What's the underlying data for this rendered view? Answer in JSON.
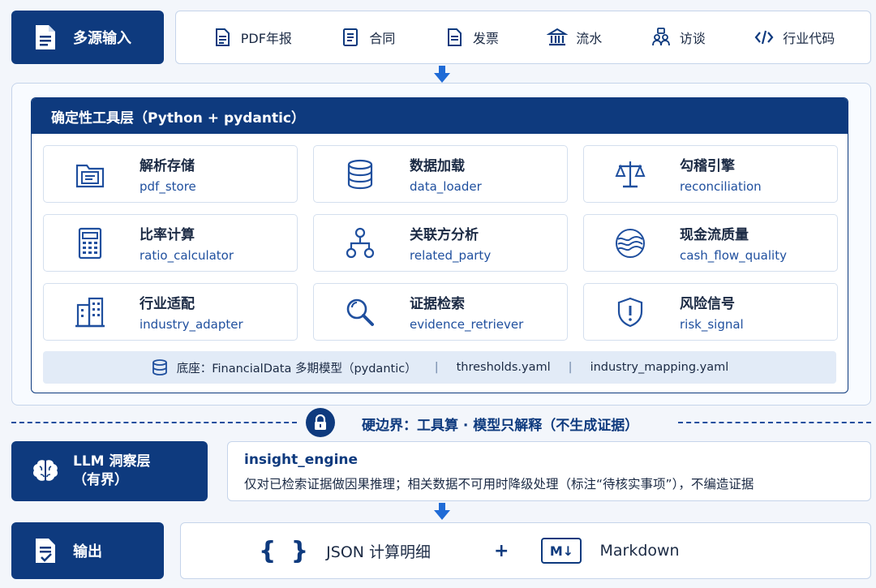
{
  "input": {
    "label": "多源输入"
  },
  "sources": [
    {
      "icon": "document-icon",
      "label": "PDF年报"
    },
    {
      "icon": "document-icon",
      "label": "合同"
    },
    {
      "icon": "receipt-icon",
      "label": "发票"
    },
    {
      "icon": "bank-icon",
      "label": "流水"
    },
    {
      "icon": "people-icon",
      "label": "访谈"
    },
    {
      "icon": "code-icon",
      "label": "行业代码"
    }
  ],
  "tools_layer": {
    "title": "确定性工具层（Python + pydantic）",
    "cards": [
      {
        "icon": "folder-icon",
        "title": "解析存储",
        "sub": "pdf_store"
      },
      {
        "icon": "database-icon",
        "title": "数据加载",
        "sub": "data_loader"
      },
      {
        "icon": "scale-icon",
        "title": "勾稽引擎",
        "sub": "reconciliation"
      },
      {
        "icon": "calculator-icon",
        "title": "比率计算",
        "sub": "ratio_calculator"
      },
      {
        "icon": "network-icon",
        "title": "关联方分析",
        "sub": "related_party"
      },
      {
        "icon": "waves-icon",
        "title": "现金流质量",
        "sub": "cash_flow_quality"
      },
      {
        "icon": "building-icon",
        "title": "行业适配",
        "sub": "industry_adapter"
      },
      {
        "icon": "search-icon",
        "title": "证据检索",
        "sub": "evidence_retriever"
      },
      {
        "icon": "shield-icon",
        "title": "风险信号",
        "sub": "risk_signal"
      }
    ],
    "base": {
      "part1": "底座：FinancialData 多期模型（pydantic）",
      "sep": "|",
      "part2": "thresholds.yaml",
      "part3": "industry_mapping.yaml"
    }
  },
  "boundary": {
    "text": "硬边界：工具算 · 模型只解释（不生成证据）"
  },
  "llm": {
    "label_line1": "LLM 洞察层",
    "label_line2": "（有界）"
  },
  "insight": {
    "title": "insight_engine",
    "desc": "仅对已检索证据做因果推理；相关数据不可用时降级处理（标注“待核实事项”），不编造证据"
  },
  "output": {
    "label": "输出",
    "brace": "{ }",
    "json_label": "JSON 计算明细",
    "plus": "+",
    "md_icon": "M↓",
    "markdown_label": "Markdown"
  },
  "colors": {
    "navy": "#0e3a7e",
    "accent": "#1f4f9e",
    "border": "#c5d4ea"
  }
}
